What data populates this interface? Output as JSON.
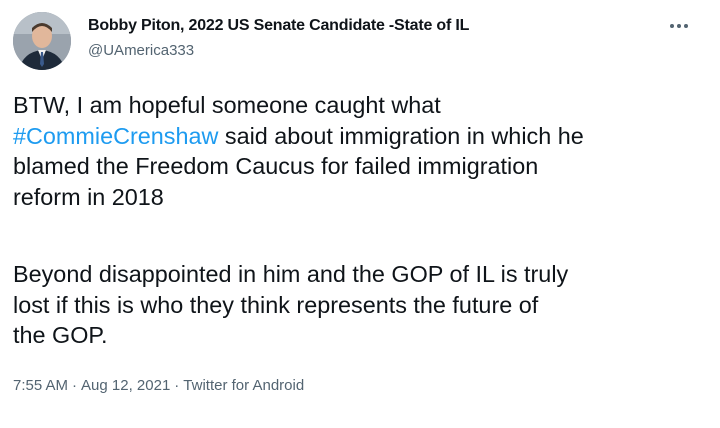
{
  "tweet": {
    "author_name": "Bobby Piton, 2022 US Senate Candidate -State of IL",
    "author_handle": "@UAmerica333",
    "more_icon": "more-horizontal-icon",
    "paragraph1": {
      "lines": [
        "BTW, I am hopeful someone caught what",
        " said about immigration in which he",
        "blamed the Freedom Caucus for failed immigration",
        "reform in 2018"
      ],
      "hashtag": "#CommieCrenshaw"
    },
    "paragraph2": {
      "lines": [
        "Beyond disappointed in him and the GOP of IL is truly",
        "lost if this is who they think represents the future of",
        "the GOP."
      ]
    },
    "time": "7:55 AM",
    "date": "Aug 12, 2021",
    "source": "Twitter for Android",
    "separator": "·",
    "colors": {
      "text": "#0f1419",
      "secondary": "#536471",
      "link": "#1d9bf0"
    }
  }
}
